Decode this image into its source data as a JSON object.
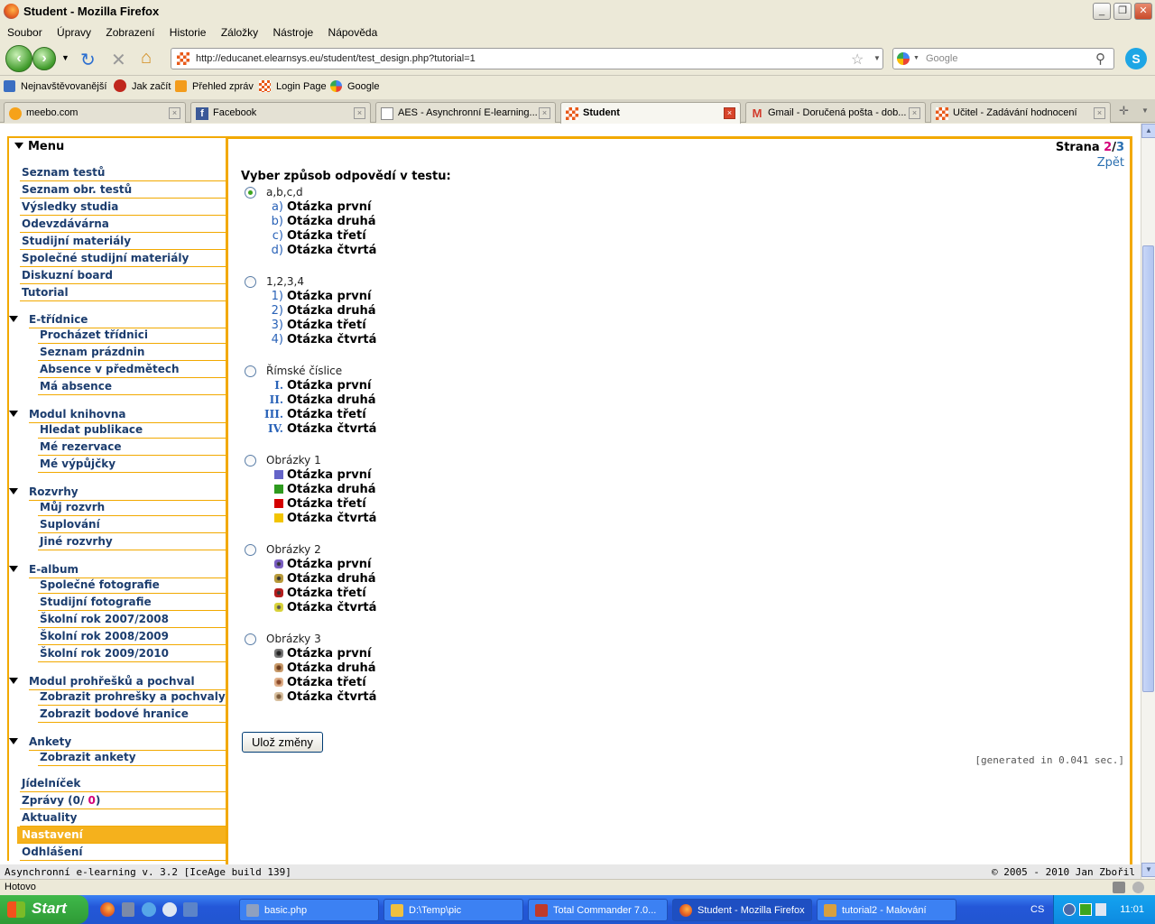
{
  "window": {
    "title": "Student - Mozilla Firefox"
  },
  "menubar": [
    "Soubor",
    "Úpravy",
    "Zobrazení",
    "Historie",
    "Záložky",
    "Nástroje",
    "Nápověda"
  ],
  "navbar": {
    "url": "http://educanet.elearnsys.eu/student/test_design.php?tutorial=1",
    "search_placeholder": "Google"
  },
  "bookmarks": [
    "Nejnavštěvovanější",
    "Jak začít",
    "Přehled zpráv",
    "Login Page",
    "Google"
  ],
  "tabs": [
    "meebo.com",
    "Facebook",
    "AES - Asynchronní E-learning...",
    "Student",
    "Gmail - Doručená pošta - dob...",
    "Učitel - Zadávání hodnocení"
  ],
  "sidebar": {
    "title": "Menu",
    "top_items": [
      "Seznam testů",
      "Seznam obr. testů",
      "Výsledky studia",
      "Odevzdávárna",
      "Studijní materiály",
      "Společné studijní materiály",
      "Diskuzní board",
      "Tutorial"
    ],
    "sections": [
      {
        "title": "E-třídnice",
        "items": [
          "Procházet třídnici",
          "Seznam prázdnin",
          "Absence v předmětech",
          "Má absence"
        ]
      },
      {
        "title": "Modul knihovna",
        "items": [
          "Hledat publikace",
          "Mé rezervace",
          "Mé výpůjčky"
        ]
      },
      {
        "title": "Rozvrhy",
        "items": [
          "Můj rozvrh",
          "Suplování",
          "Jiné rozvrhy"
        ]
      },
      {
        "title": "E-album",
        "items": [
          "Společné fotografie",
          "Studijní fotografie",
          "Školní rok 2007/2008",
          "Školní rok 2008/2009",
          "Školní rok 2009/2010"
        ]
      },
      {
        "title": "Modul prohřešků a pochval",
        "items": [
          "Zobrazit prohrešky a pochvaly",
          "Zobrazit bodové hranice"
        ]
      },
      {
        "title": "Ankety",
        "items": [
          "Zobrazit ankety"
        ]
      }
    ],
    "bottom_items": {
      "jidelnicek": "Jídelníček",
      "zpravy_prefix": "Zprávy (0/ ",
      "zpravy_count": "0",
      "zpravy_suffix": ")",
      "aktuality": "Aktuality",
      "nastaveni": "Nastavení",
      "odhlaseni": "Odhlášení"
    }
  },
  "pager": {
    "label": "Strana",
    "current": "2",
    "sep": "/",
    "total": "3",
    "back": "Zpět"
  },
  "form": {
    "heading": "Vyber způsob odpovědí v testu:",
    "selected_option": "a,b,c,d",
    "options": [
      {
        "label": "a,b,c,d",
        "markers": [
          "a)",
          "b)",
          "c)",
          "d)"
        ]
      },
      {
        "label": "1,2,3,4",
        "markers": [
          "1)",
          "2)",
          "3)",
          "4)"
        ]
      },
      {
        "label": "Římské číslice",
        "markers": [
          "I.",
          "II.",
          "III.",
          "IV."
        ]
      },
      {
        "label": "Obrázky 1",
        "colors": [
          "#6464c8",
          "#2e9a1e",
          "#d40000",
          "#f2c400"
        ]
      },
      {
        "label": "Obrázky 2",
        "icons": [
          "purple-butterfly-icon",
          "orange-butterfly-icon",
          "red-butterfly-icon",
          "yellow-bug-icon"
        ]
      },
      {
        "label": "Obrázky 3",
        "icons": [
          "cat-icon-1",
          "cat-icon-2",
          "cat-icon-3",
          "cat-icon-4"
        ]
      }
    ],
    "questions": [
      "Otázka první",
      "Otázka druhá",
      "Otázka třetí",
      "Otázka čtvrtá"
    ],
    "save_label": "Ulož změny",
    "generated": "[generated in 0.041 sec.]"
  },
  "footer": {
    "left": "Asynchronní e-learning  v. 3.2 [IceAge build 139]",
    "right": "© 2005 - 2010  Jan Zbořil"
  },
  "status": "Hotovo",
  "taskbar": {
    "start": "Start",
    "tasks": [
      "basic.php",
      "D:\\Temp\\pic",
      "Total Commander 7.0...",
      "Student - Mozilla Firefox",
      "tutorial2 - Malování"
    ],
    "lang": "CS",
    "clock": "11:01"
  },
  "colors": {
    "accent": "#f2a900",
    "link": "#1c3d6e",
    "highlight": "#f5b11c"
  }
}
